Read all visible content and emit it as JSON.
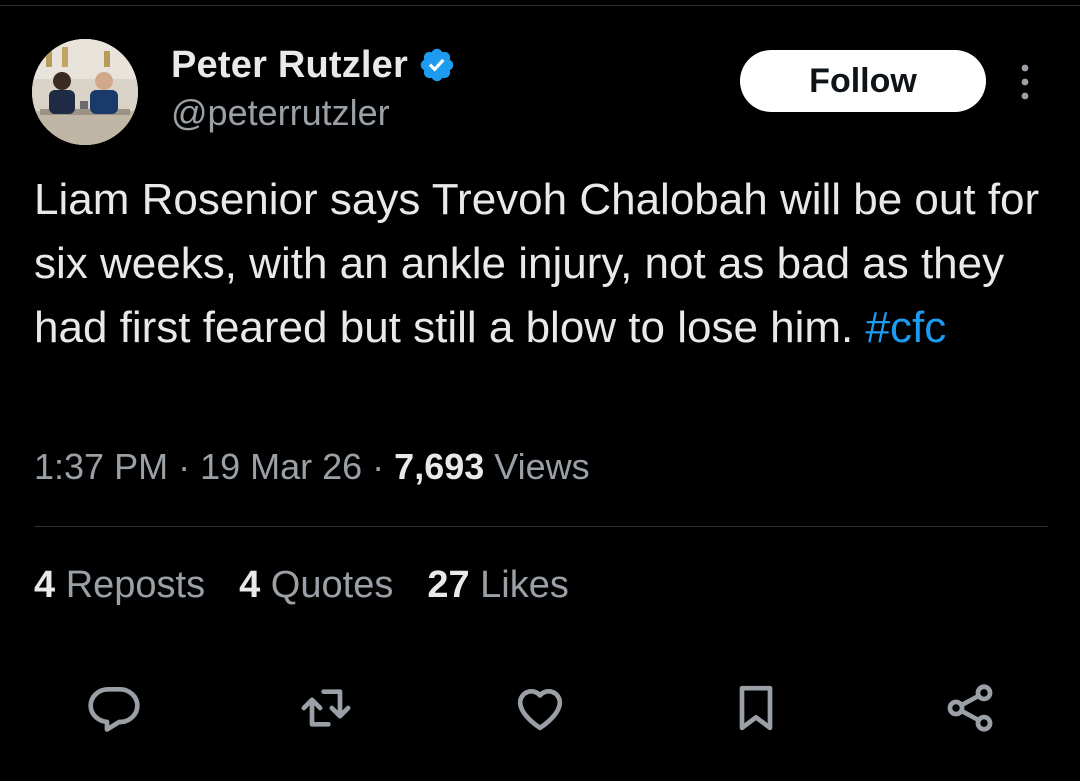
{
  "author": {
    "display_name": "Peter Rutzler",
    "handle": "@peterrutzler",
    "verified": true
  },
  "follow_button": {
    "label": "Follow"
  },
  "tweet": {
    "text": "Liam Rosenior says Trevoh Chalobah will be out for six weeks, with an ankle injury, not as bad as they had first feared but still a blow to lose him. ",
    "hashtag": "#cfc"
  },
  "meta": {
    "time": "1:37 PM",
    "date": "19 Mar 26",
    "separator": " · ",
    "views_count": "7,693",
    "views_label": " Views"
  },
  "stats": {
    "reposts_count": "4",
    "reposts_label": " Reposts",
    "quotes_count": "4",
    "quotes_label": " Quotes",
    "likes_count": "27",
    "likes_label": " Likes"
  },
  "actions": [
    "reply-icon",
    "repost-icon",
    "like-icon",
    "bookmark-icon",
    "share-icon"
  ],
  "colors": {
    "background": "#000000",
    "text": "#e7e9ea",
    "secondary_text": "#9aa0a6",
    "accent": "#1d9bf0",
    "verified_badge": "#1d9bf0"
  }
}
